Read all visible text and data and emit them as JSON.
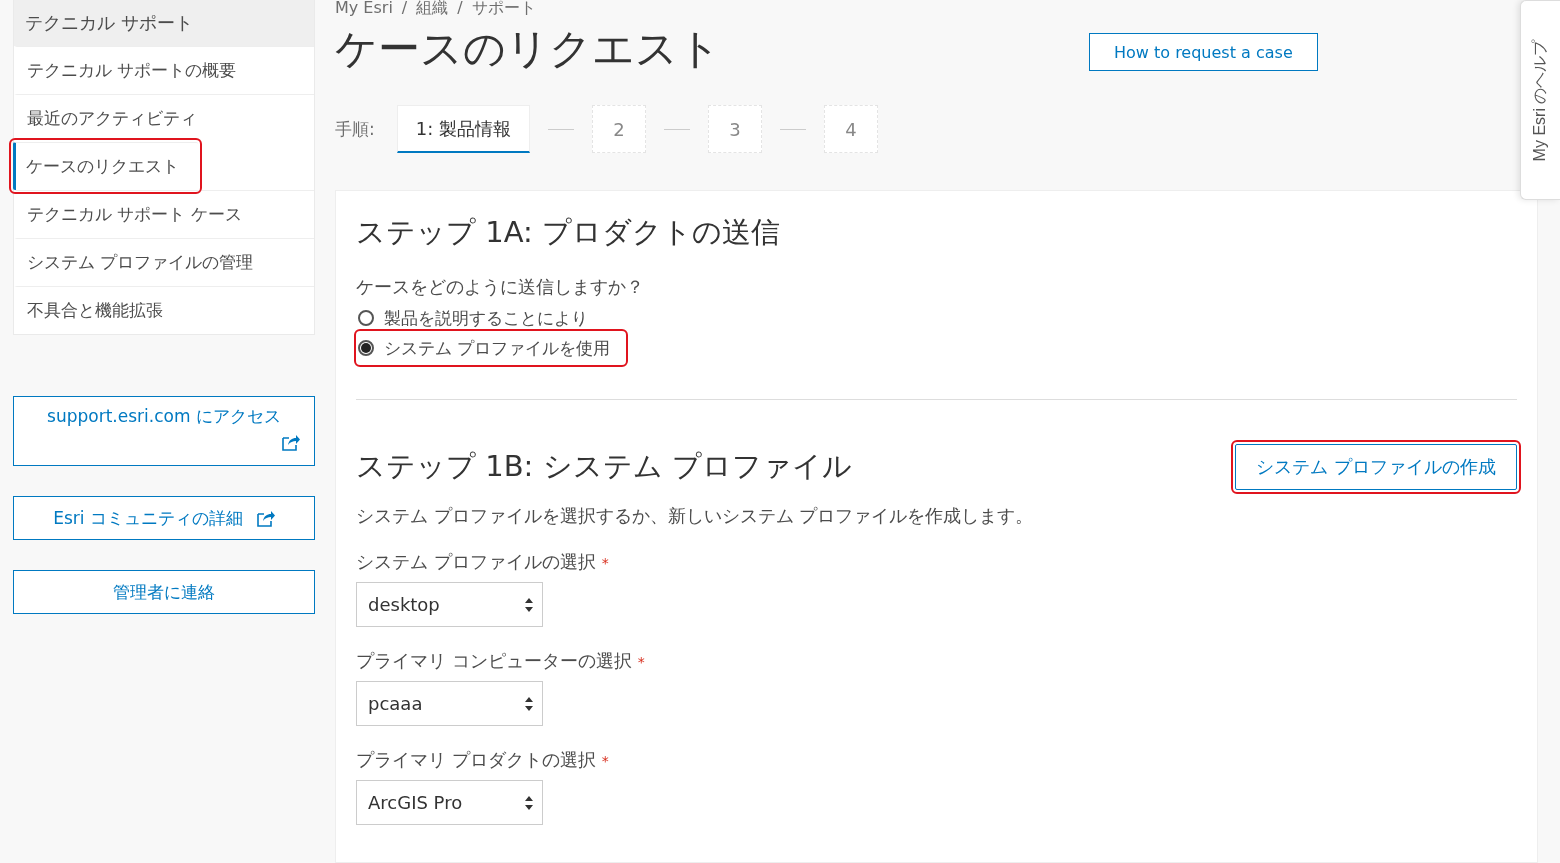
{
  "sidebar": {
    "header": "テクニカル サポート",
    "items": [
      {
        "label": "テクニカル サポートの概要",
        "selected": false,
        "highlighted": false
      },
      {
        "label": "最近のアクティビティ",
        "selected": false,
        "highlighted": false
      },
      {
        "label": "ケースのリクエスト",
        "selected": true,
        "highlighted": true
      },
      {
        "label": "テクニカル サポート ケース",
        "selected": false,
        "highlighted": false
      },
      {
        "label": "システム プロファイルの管理",
        "selected": false,
        "highlighted": false
      },
      {
        "label": "不具合と機能拡張",
        "selected": false,
        "highlighted": false
      }
    ],
    "links": [
      {
        "label": "support.esri.com にアクセス",
        "external": true,
        "kind": "tall"
      },
      {
        "label": "Esri コミュニティの詳細",
        "external": true,
        "kind": "inline"
      },
      {
        "label": "管理者に連絡",
        "external": false,
        "kind": "inline"
      }
    ]
  },
  "breadcrumb": {
    "separator": "/",
    "items": [
      "My Esri",
      "組織",
      "サポート"
    ]
  },
  "title": "ケースのリクエスト",
  "help_button": "How to request a case",
  "steps": {
    "label": "手順:",
    "items": [
      {
        "label": "1:  製品情報",
        "selected": true
      },
      {
        "label": "2",
        "selected": false
      },
      {
        "label": "3",
        "selected": false
      },
      {
        "label": "4",
        "selected": false
      }
    ]
  },
  "step_1a": {
    "heading": "ステップ 1A: プロダクトの送信",
    "question": "ケースをどのように送信しますか？",
    "options": [
      {
        "label": "製品を説明することにより",
        "selected": false,
        "highlighted": false
      },
      {
        "label": "システム プロファイルを使用",
        "selected": true,
        "highlighted": true
      }
    ]
  },
  "step_1b": {
    "heading": "ステップ 1B: システム プロファイル",
    "create_button": {
      "label": "システム プロファイルの作成",
      "highlighted": true
    },
    "description": "システム プロファイルを選択するか、新しいシステム プロファイルを作成します。",
    "fields": [
      {
        "label": "システム プロファイルの選択",
        "required_mark": "*",
        "value": "desktop"
      },
      {
        "label": "プライマリ コンピューターの選択",
        "required_mark": "*",
        "value": "pcaaa"
      },
      {
        "label": "プライマリ プロダクトの選択",
        "required_mark": "*",
        "value": "ArcGIS Pro"
      }
    ]
  },
  "help_tab": "My Esri のヘルプ"
}
